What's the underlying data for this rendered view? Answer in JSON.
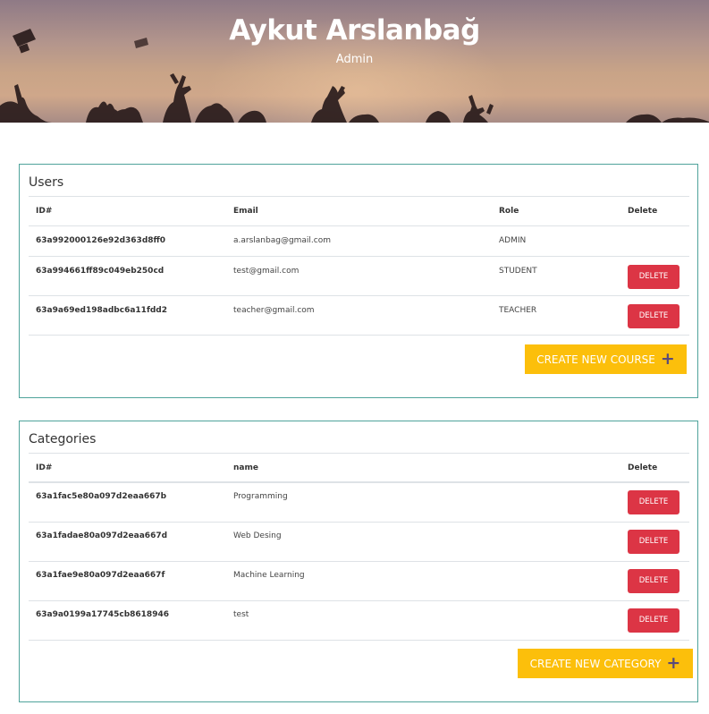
{
  "header": {
    "name": "Aykut Arslanbağ",
    "role": "Admin"
  },
  "users": {
    "title": "Users",
    "columns": {
      "id": "ID#",
      "email": "Email",
      "role": "Role",
      "delete": "Delete"
    },
    "rows": [
      {
        "id": "63a992000126e92d363d8ff0",
        "email": "a.arslanbag@gmail.com",
        "role": "ADMIN",
        "delete_label": ""
      },
      {
        "id": "63a994661ff89c049eb250cd",
        "email": "test@gmail.com",
        "role": "STUDENT",
        "delete_label": "DELETE"
      },
      {
        "id": "63a9a69ed198adbc6a11fdd2",
        "email": "teacher@gmail.com",
        "role": "TEACHER",
        "delete_label": "DELETE"
      }
    ],
    "create_label": "CREATE NEW COURSE"
  },
  "categories": {
    "title": "Categories",
    "columns": {
      "id": "ID#",
      "name": "name",
      "delete": "Delete"
    },
    "rows": [
      {
        "id": "63a1fac5e80a097d2eaa667b",
        "name": "Programming",
        "delete_label": "DELETE"
      },
      {
        "id": "63a1fadae80a097d2eaa667d",
        "name": "Web Desing",
        "delete_label": "DELETE"
      },
      {
        "id": "63a1fae9e80a097d2eaa667f",
        "name": "Machine Learning",
        "delete_label": "DELETE"
      },
      {
        "id": "63a9a0199a17745cb8618946",
        "name": "test",
        "delete_label": "DELETE"
      }
    ],
    "create_label": "CREATE NEW CATEGORY"
  },
  "icons": {
    "create_course": "plus-icon",
    "create_category": "plus-icon"
  },
  "colors": {
    "panel_border": "#4fa39b",
    "delete_button": "#dc3545",
    "create_button": "#fcbf0b",
    "plus_icon": "#5a4a7a"
  }
}
